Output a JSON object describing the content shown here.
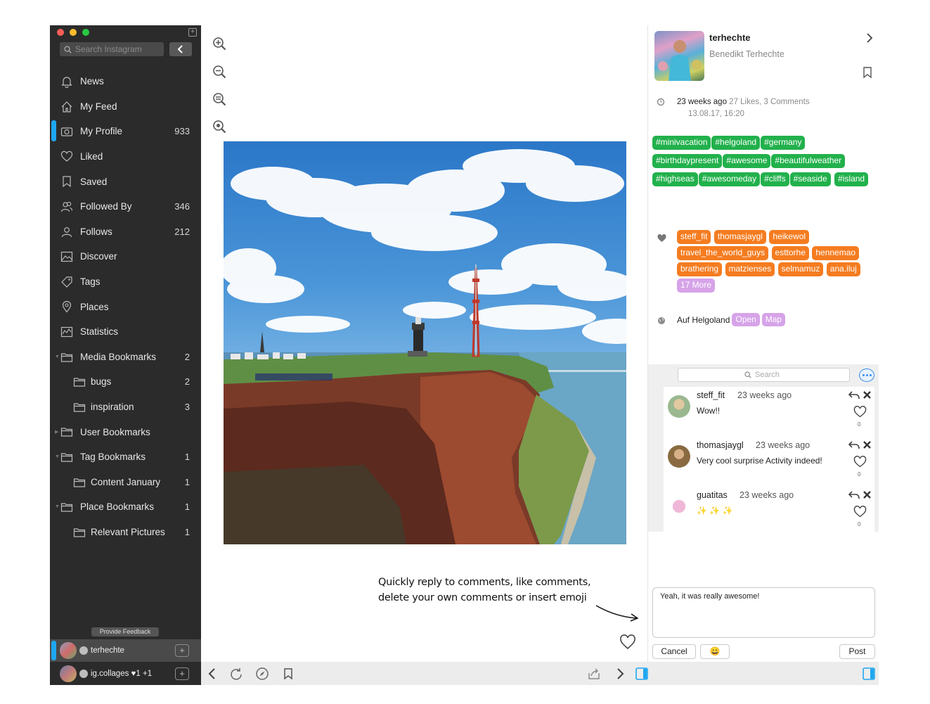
{
  "sidebar": {
    "search_placeholder": "Search Instagram",
    "items": [
      {
        "label": "News",
        "count": "",
        "icon": "bell-icon"
      },
      {
        "label": "My Feed",
        "count": "",
        "icon": "house-icon"
      },
      {
        "label": "My Profile",
        "count": "933",
        "icon": "camera-icon"
      },
      {
        "label": "Liked",
        "count": "",
        "icon": "heart-icon"
      },
      {
        "label": "Saved",
        "count": "",
        "icon": "bookmark-icon"
      },
      {
        "label": "Followed By",
        "count": "346",
        "icon": "people-icon"
      },
      {
        "label": "Follows",
        "count": "212",
        "icon": "person-icon"
      },
      {
        "label": "Discover",
        "count": "",
        "icon": "image-icon"
      },
      {
        "label": "Tags",
        "count": "",
        "icon": "tag-icon"
      },
      {
        "label": "Places",
        "count": "",
        "icon": "pin-icon"
      },
      {
        "label": "Statistics",
        "count": "",
        "icon": "chart-icon"
      },
      {
        "label": "Media Bookmarks",
        "count": "2",
        "icon": "folder-icon"
      },
      {
        "label": "bugs",
        "count": "2",
        "icon": "folder-icon"
      },
      {
        "label": "inspiration",
        "count": "3",
        "icon": "folder-icon"
      },
      {
        "label": "User Bookmarks",
        "count": "",
        "icon": "folder-icon"
      },
      {
        "label": "Tag Bookmarks",
        "count": "1",
        "icon": "folder-icon"
      },
      {
        "label": "Content January",
        "count": "1",
        "icon": "folder-icon"
      },
      {
        "label": "Place Bookmarks",
        "count": "1",
        "icon": "folder-icon"
      },
      {
        "label": "Relevant Pictures",
        "count": "1",
        "icon": "folder-icon"
      }
    ],
    "feedback_label": "Provide Feedback",
    "accounts": [
      {
        "name": "terhechte"
      },
      {
        "name": "ig.collages",
        "likes": "♥1",
        "extra": "+1"
      }
    ]
  },
  "annotation": {
    "line1": "Quickly reply to comments, like comments,",
    "line2": "delete your own comments or insert emoji"
  },
  "post": {
    "username": "terhechte",
    "fullname": "Benedikt Terhechte",
    "time_ago": "23 weeks ago",
    "stats": "27 Likes, 3 Comments",
    "date": "13.08.17, 16:20",
    "hashtags": [
      "#minivacation",
      "#helgoland",
      "#germany",
      "#birthdaypresent",
      "#awesome",
      "#beautifulweather",
      "#highseas",
      "#awesomeday",
      "#cliffs",
      "#seaside",
      "#island"
    ],
    "likers": [
      "steff_fit",
      "thomasjaygl",
      "heikewol",
      "travel_the_world_guys",
      "esttorhe",
      "hennemao",
      "brathering",
      "matzienses",
      "selmamuz",
      "ana.iluj"
    ],
    "more_likers": "17 More",
    "place": "Auf Helgoland",
    "place_open": "Open",
    "place_map": "Map"
  },
  "comments": {
    "search_placeholder": "Search",
    "items": [
      {
        "user": "steff_fit",
        "time": "23 weeks ago",
        "text": "Wow!!",
        "likes": "0"
      },
      {
        "user": "thomasjaygl",
        "time": "23 weeks ago",
        "text": "Very cool surprise Activity indeed!",
        "likes": "0"
      },
      {
        "user": "guatitas",
        "time": "23 weeks ago",
        "text": "✨ ✨ ✨",
        "likes": "0"
      }
    ]
  },
  "reply": {
    "value": "Yeah, it was really awesome!",
    "cancel_label": "Cancel",
    "emoji_label": "😀",
    "post_label": "Post"
  },
  "colors": {
    "accent": "#1ea7f0",
    "hashtag": "#22b14c",
    "liker": "#f57c20",
    "pill_purple": "#d6a3e8"
  }
}
